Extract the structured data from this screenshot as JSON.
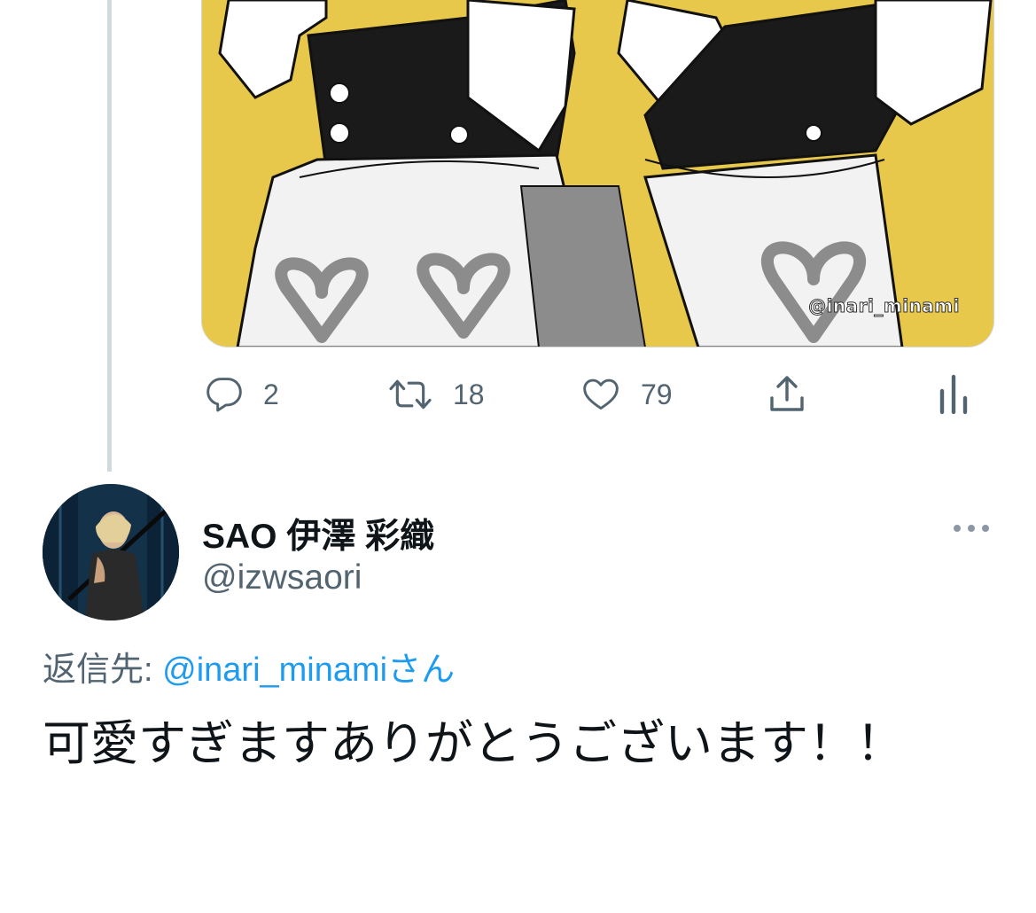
{
  "thread": {
    "media": {
      "watermark": "@inari_minami"
    },
    "actions": {
      "reply": {
        "icon": "reply-icon",
        "count": "2"
      },
      "retweet": {
        "icon": "retweet-icon",
        "count": "18"
      },
      "like": {
        "icon": "heart-icon",
        "count": "79"
      },
      "share": {
        "icon": "share-icon"
      },
      "analytics": {
        "icon": "analytics-icon"
      }
    }
  },
  "reply_tweet": {
    "author": {
      "display_name": "SAO 伊澤 彩織",
      "handle": "@izwsaori"
    },
    "reply_to_label": "返信先: ",
    "reply_to_mention": "@inari_minamiさん",
    "text": "可愛すぎますありがとうございます！！"
  },
  "colors": {
    "secondary_text": "#536471",
    "link": "#1d9bf0",
    "thread_line": "#cfd9de",
    "media_background": "#e8c84a"
  }
}
